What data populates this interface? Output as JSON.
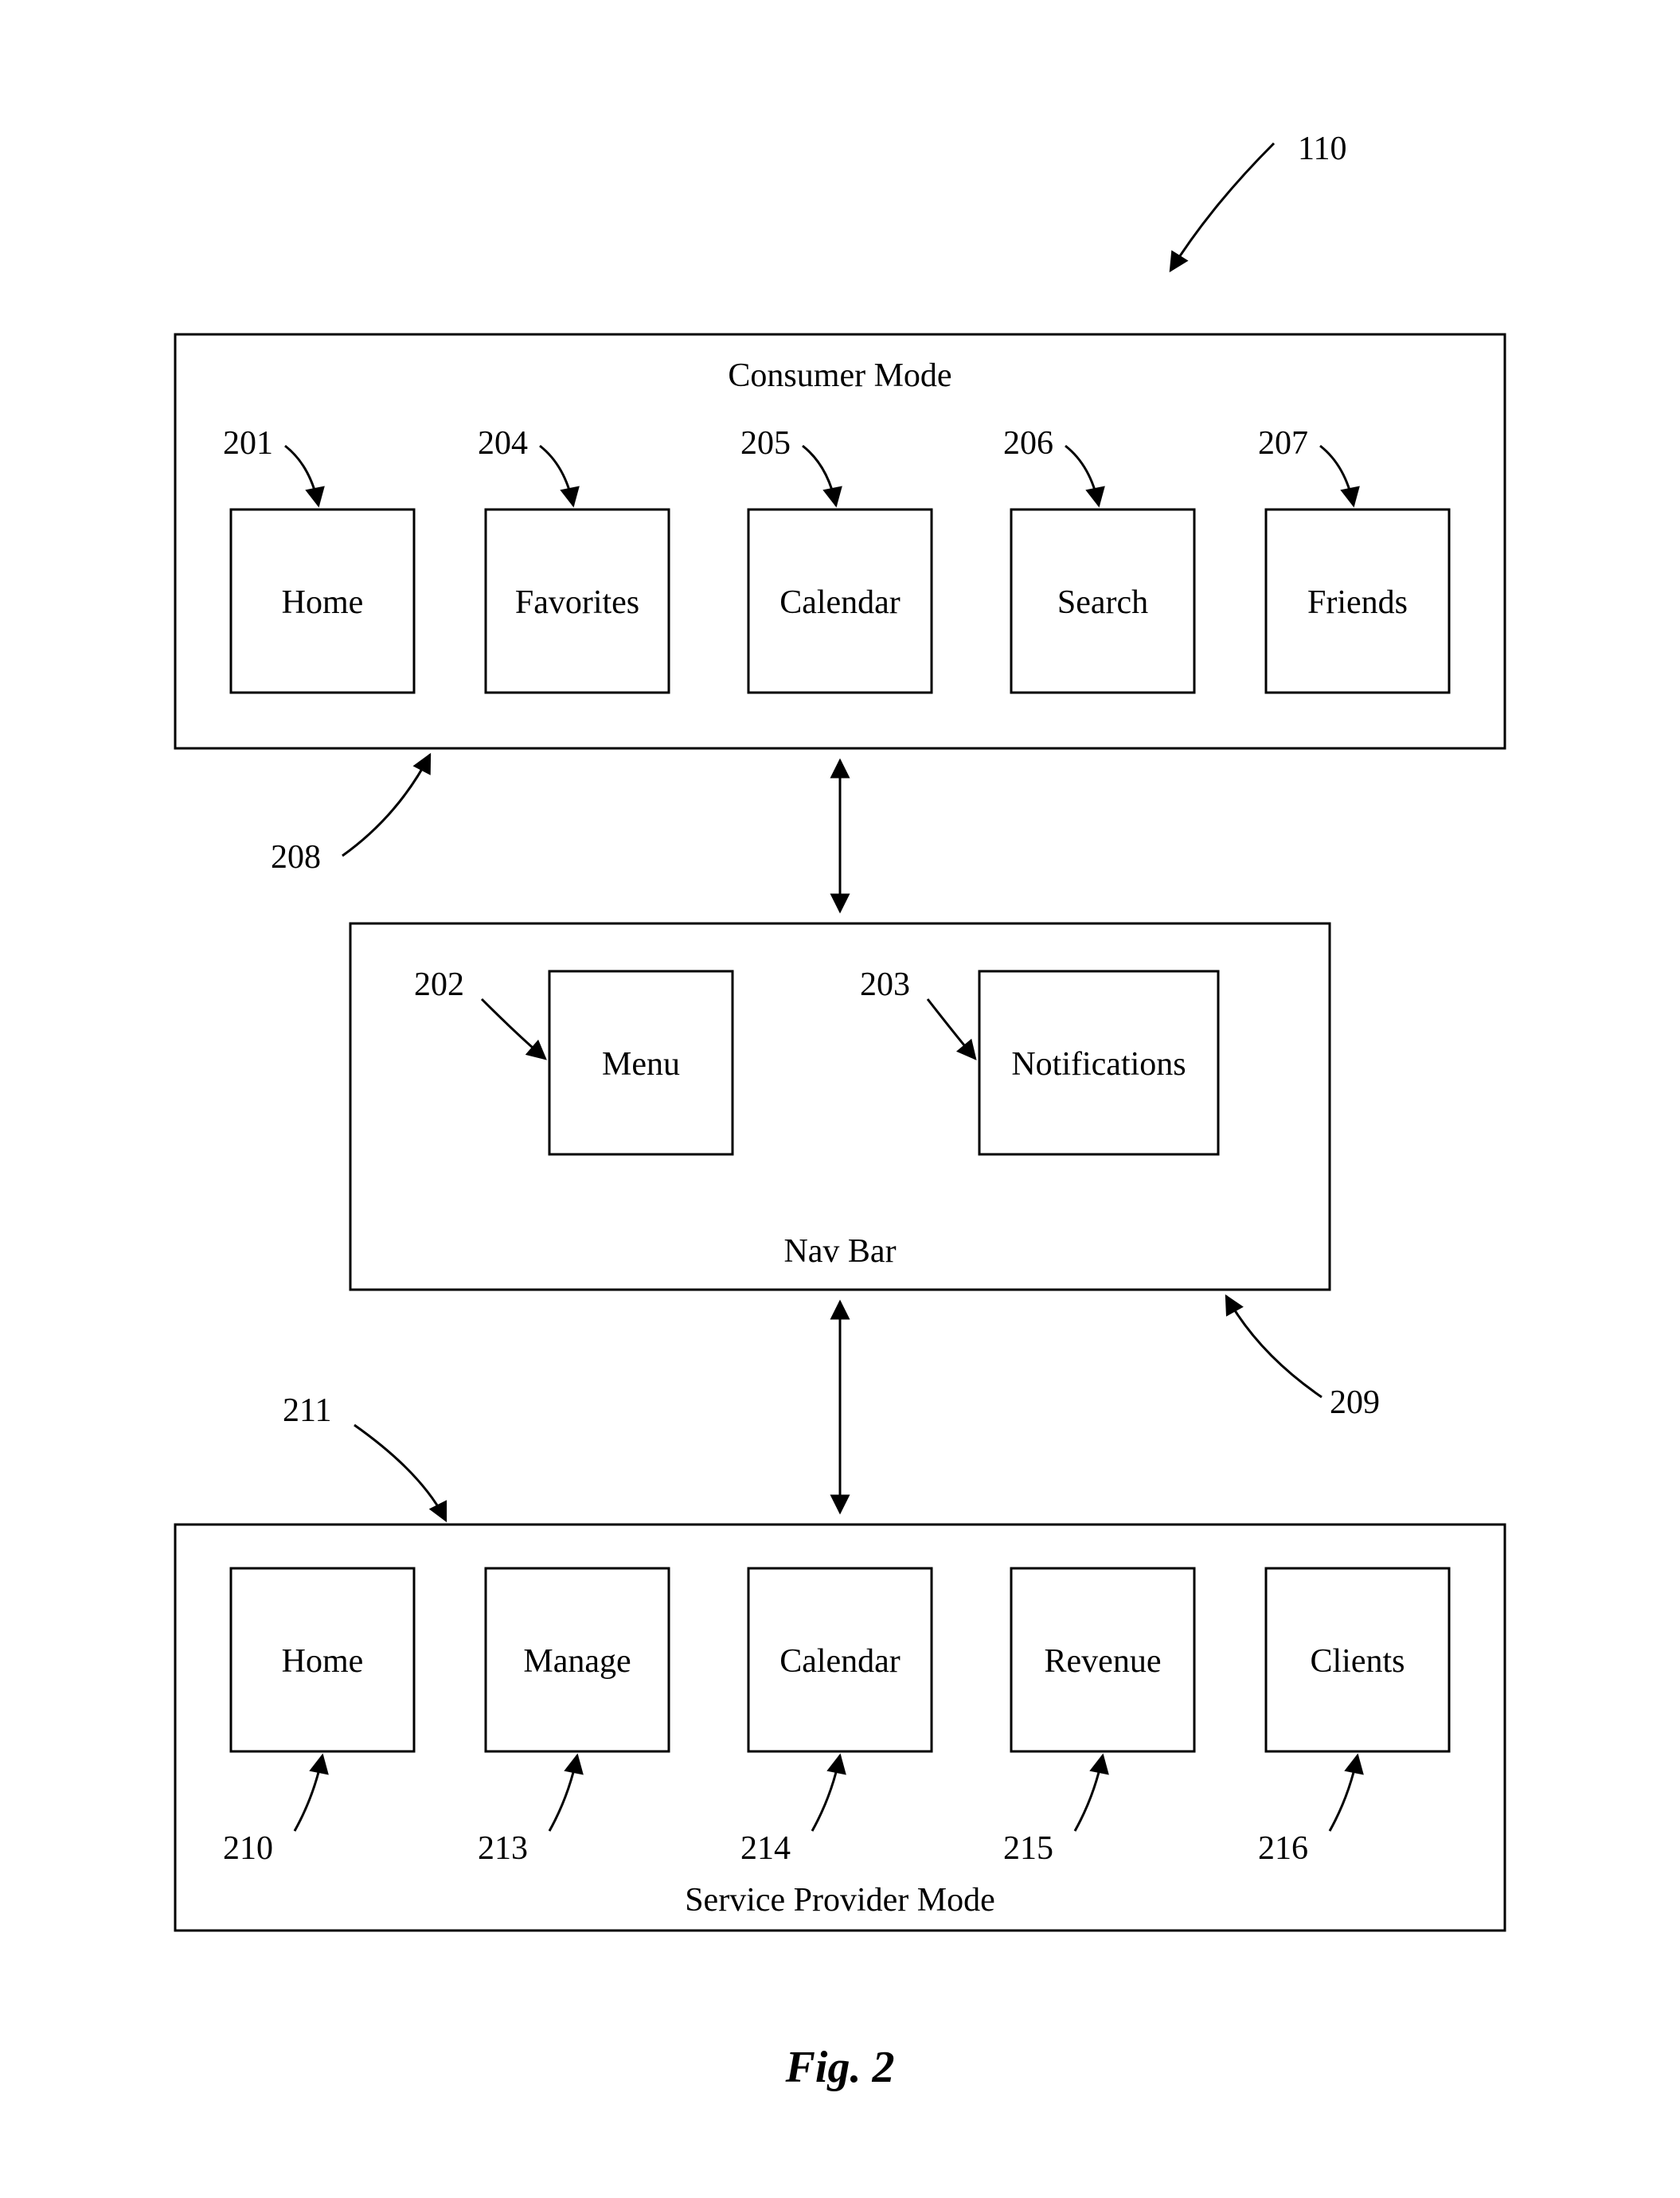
{
  "figure": {
    "caption": "Fig. 2",
    "ref_overall": "110"
  },
  "consumer": {
    "title": "Consumer Mode",
    "ref_container": "208",
    "boxes": [
      {
        "label": "Home",
        "ref": "201"
      },
      {
        "label": "Favorites",
        "ref": "204"
      },
      {
        "label": "Calendar",
        "ref": "205"
      },
      {
        "label": "Search",
        "ref": "206"
      },
      {
        "label": "Friends",
        "ref": "207"
      }
    ]
  },
  "navbar": {
    "title": "Nav Bar",
    "ref_container": "209",
    "boxes": [
      {
        "label": "Menu",
        "ref": "202"
      },
      {
        "label": "Notifications",
        "ref": "203"
      }
    ]
  },
  "provider": {
    "title": "Service Provider Mode",
    "ref_container": "211",
    "boxes": [
      {
        "label": "Home",
        "ref": "210"
      },
      {
        "label": "Manage",
        "ref": "213"
      },
      {
        "label": "Calendar",
        "ref": "214"
      },
      {
        "label": "Revenue",
        "ref": "215"
      },
      {
        "label": "Clients",
        "ref": "216"
      }
    ]
  }
}
